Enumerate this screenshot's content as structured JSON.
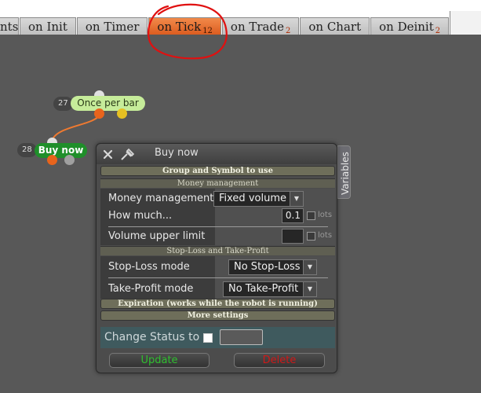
{
  "tabs": [
    {
      "label": "nts",
      "count": ""
    },
    {
      "label": "on Init",
      "count": ""
    },
    {
      "label": "on Timer",
      "count": ""
    },
    {
      "label": "on Tick",
      "count": "12"
    },
    {
      "label": "on Trade",
      "count": "2"
    },
    {
      "label": "on Chart",
      "count": ""
    },
    {
      "label": "on Deinit",
      "count": "2"
    }
  ],
  "active_tab": "on Tick",
  "nodes": {
    "once_per_bar": {
      "number": "27",
      "label": "Once per bar"
    },
    "buy_now": {
      "number": "28",
      "label": "Buy now"
    }
  },
  "dialog": {
    "title": "Buy now",
    "variables_tab": "Variables",
    "sections": {
      "group_symbol": "Group and Symbol to use",
      "money_management": "Money management",
      "sl_tp": "Stop-Loss and Take-Profit",
      "expiration": "Expiration (works while the robot is running)",
      "more_settings": "More settings"
    },
    "fields": {
      "money_management_label": "Money management",
      "money_management_value": "Fixed volume",
      "how_much_label": "How much...",
      "how_much_value": "0.1",
      "how_much_unit": "lots",
      "volume_upper_label": "Volume upper limit",
      "volume_upper_value": "",
      "volume_upper_unit": "lots",
      "sl_mode_label": "Stop-Loss mode",
      "sl_mode_value": "No Stop-Loss",
      "tp_mode_label": "Take-Profit mode",
      "tp_mode_value": "No Take-Profit",
      "status_label": "Change Status to",
      "status_value": ""
    },
    "buttons": {
      "update": "Update",
      "delete": "Delete"
    }
  },
  "colors": {
    "canvas": "#585858",
    "active_tab": "#e8692c",
    "annotation": "#e01010",
    "node_light": "#c6ec9a",
    "node_green": "#1f8f2a",
    "update_text": "#2fbf2f",
    "delete_text": "#d01818"
  },
  "icons": [
    "close-icon",
    "pin-icon",
    "chevron-down-icon"
  ]
}
